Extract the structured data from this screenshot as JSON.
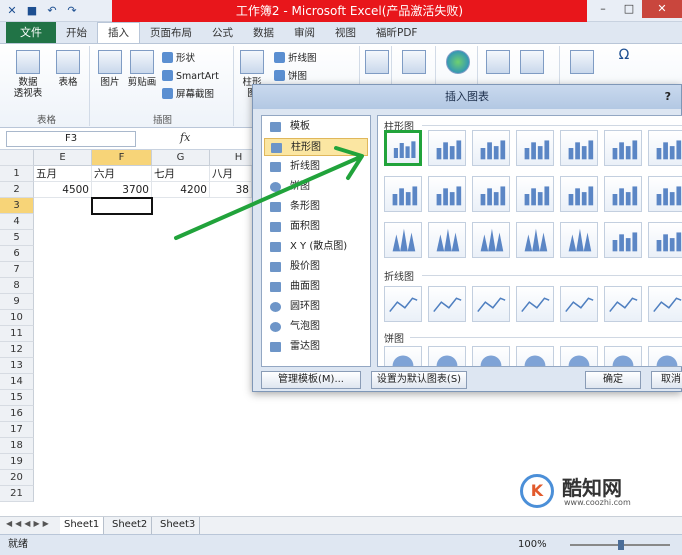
{
  "window": {
    "title": "工作簿2 - Microsoft Excel(产品激活失败)",
    "min": "–",
    "max": "□",
    "close": "✕"
  },
  "ribbon_tabs": [
    "文件",
    "开始",
    "插入",
    "页面布局",
    "公式",
    "数据",
    "审阅",
    "视图",
    "福昕PDF"
  ],
  "ribbon": {
    "pivot_table": "数据\n透视表",
    "table": "表格",
    "group_tables": "表格",
    "picture": "图片",
    "clipart": "剪贴画",
    "shapes": "形状",
    "smartart": "SmartArt",
    "screenshot": "屏幕截图",
    "group_illustrations": "插图",
    "column_chart": "柱形图",
    "line_chart": "折线图",
    "pie_chart": "饼图",
    "sparkline_line": "折线图",
    "hyperlink": "超链接",
    "textbox": "文本框",
    "symbol": "符号"
  },
  "formula_bar": {
    "name_box": "F3",
    "fx": "fx"
  },
  "grid": {
    "columns": [
      "E",
      "F",
      "G",
      "H"
    ],
    "rows": [
      "1",
      "2",
      "3",
      "4",
      "5",
      "6",
      "7",
      "8",
      "9",
      "10",
      "11",
      "12",
      "13",
      "14",
      "15",
      "16",
      "17",
      "18",
      "19",
      "20",
      "21"
    ],
    "row1": [
      "五月",
      "六月",
      "七月",
      "八月"
    ],
    "row2": [
      "4500",
      "3700",
      "4200",
      "38"
    ]
  },
  "sheets": [
    "Sheet1",
    "Sheet2",
    "Sheet3"
  ],
  "sheet_nav": "◀◀◀▶▶",
  "status": {
    "ready": "就绪",
    "zoom": "100%"
  },
  "dialog": {
    "title": "插入图表",
    "help": "?",
    "categories": [
      "模板",
      "柱形图",
      "折线图",
      "饼图",
      "条形图",
      "面积图",
      "X Y (散点图)",
      "股价图",
      "曲面图",
      "圆环图",
      "气泡图",
      "雷达图"
    ],
    "section_column": "柱形图",
    "section_line": "折线图",
    "section_pie": "饼图",
    "btn_manage": "管理模板(M)...",
    "btn_default": "设置为默认图表(S)",
    "btn_ok": "确定",
    "btn_cancel": "取消"
  },
  "watermark": {
    "logo": "K",
    "name": "酷知网",
    "url": "www.coozhi.com"
  },
  "colors": {
    "title_red": "#e8161b",
    "highlight_green": "#21a33b",
    "file_tab": "#217346"
  }
}
